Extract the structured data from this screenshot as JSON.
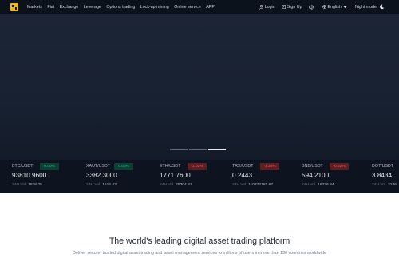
{
  "nav": {
    "links": [
      "Markets",
      "Fiat",
      "Exchange",
      "Leverage",
      "Options trading",
      "Lock-up mining",
      "Online service",
      "APP"
    ],
    "login": "Login",
    "signup": "Sign Up",
    "language": "English",
    "night_mode": "Night mode"
  },
  "ticker": {
    "vol_label": "24H Vol",
    "items": [
      {
        "pair": "BTC/USDT",
        "change": "0.00%",
        "direction": "up",
        "price": "93810.9600",
        "volume": "1818.05"
      },
      {
        "pair": "XAUT/USDT",
        "change": "0.00%",
        "direction": "up",
        "price": "3382.3000",
        "volume": "1516.43"
      },
      {
        "pair": "ETH/USDT",
        "change": "-1.02%",
        "direction": "down",
        "price": "1771.7600",
        "volume": "25304.81"
      },
      {
        "pair": "TRX/USDT",
        "change": "-1.30%",
        "direction": "down",
        "price": "0.2443",
        "volume": "110372181.67"
      },
      {
        "pair": "BNB/USDT",
        "change": "-0.52%",
        "direction": "down",
        "price": "594.2100",
        "volume": "16776.34"
      },
      {
        "pair": "DOT/USDT",
        "change": "",
        "direction": "down",
        "price": "3.8434",
        "volume": "2276"
      }
    ]
  },
  "main": {
    "headline": "The world's leading digital asset trading platform",
    "subline": "Deliver secure, trusted digital asset trading and asset management services to millions of users in more than 130 countries worldwide"
  },
  "colors": {
    "brand": "#f0b90b",
    "up": "#2bb88b",
    "down": "#f05a5f"
  }
}
